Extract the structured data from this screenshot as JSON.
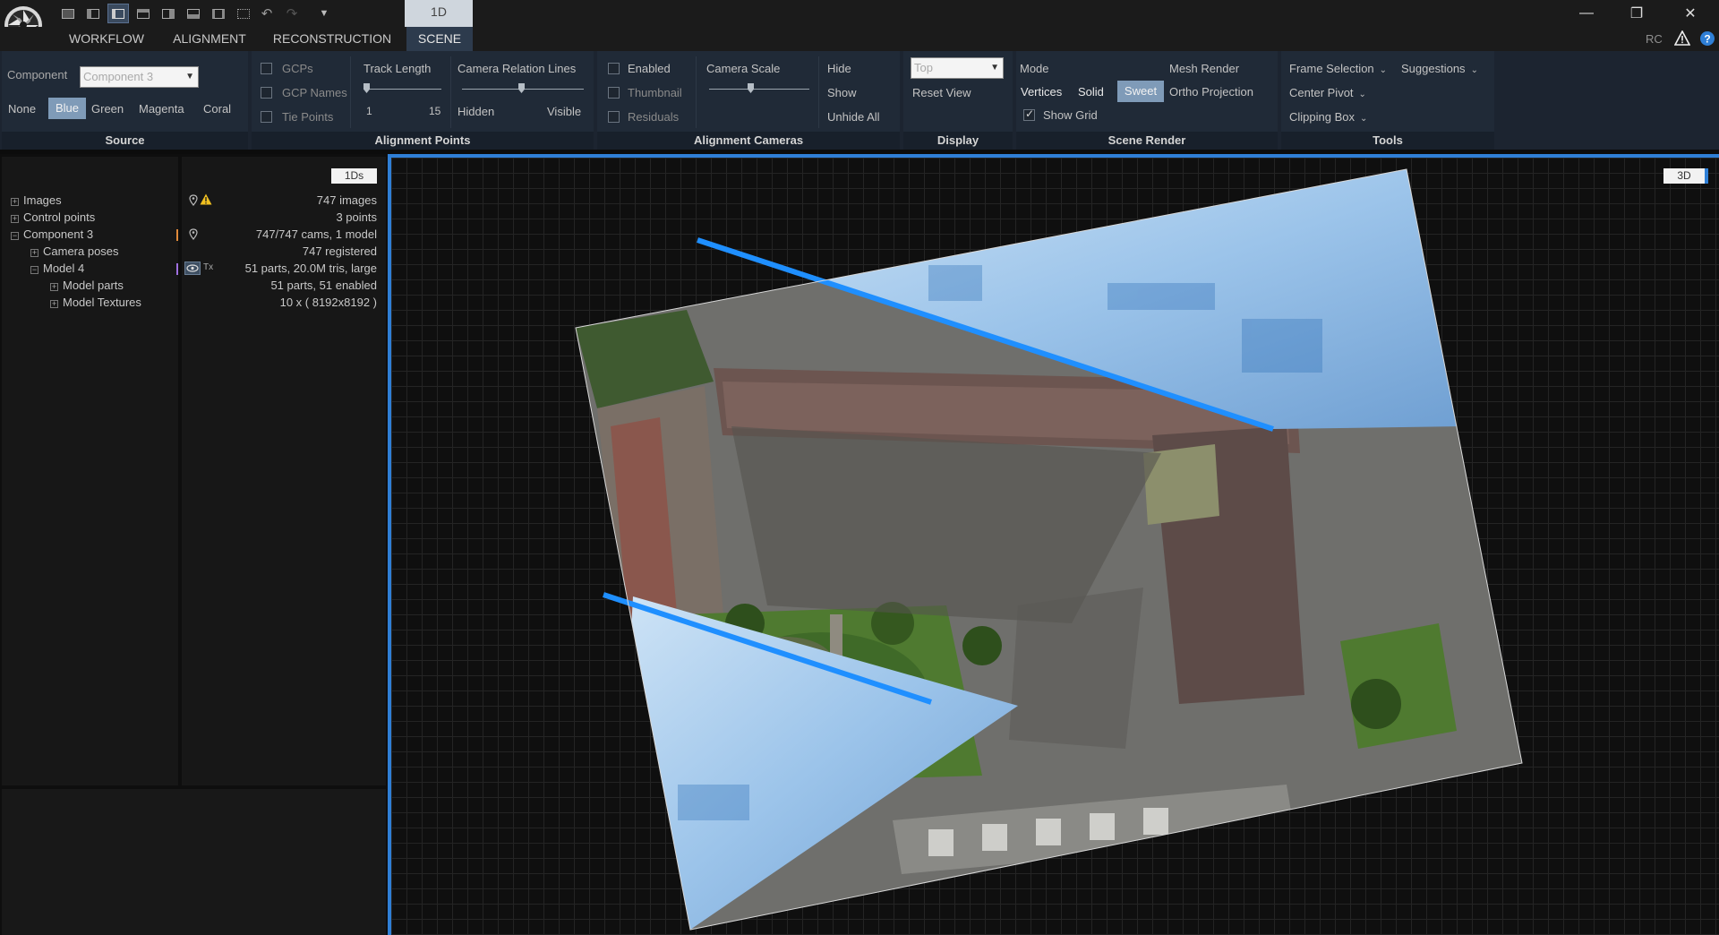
{
  "titlebar": {
    "tab_1d": "1D",
    "minimize": "—",
    "restore": "❐",
    "close": "✕"
  },
  "menu": {
    "tabs": [
      "WORKFLOW",
      "ALIGNMENT",
      "RECONSTRUCTION",
      "SCENE"
    ],
    "active_tab": "SCENE",
    "rc": "RC"
  },
  "source": {
    "component_label": "Component",
    "component_value": "Component 3",
    "colors": [
      "None",
      "Blue",
      "Green",
      "Magenta",
      "Coral"
    ],
    "selected_color": "Blue",
    "title": "Source"
  },
  "alignment_points": {
    "gcps": "GCPs",
    "gcp_names": "GCP Names",
    "tie_points": "Tie Points",
    "track_length": "Track Length",
    "track_min": "1",
    "track_max": "15",
    "camera_relation_lines": "Camera Relation Lines",
    "hidden": "Hidden",
    "visible": "Visible",
    "title": "Alignment Points"
  },
  "alignment_cameras": {
    "enabled": "Enabled",
    "thumbnail": "Thumbnail",
    "residuals": "Residuals",
    "camera_scale": "Camera Scale",
    "hide": "Hide",
    "show": "Show",
    "unhide_all": "Unhide All",
    "title": "Alignment Cameras"
  },
  "display": {
    "view_placeholder": "Top",
    "reset_view": "Reset View",
    "title": "Display"
  },
  "scene_render": {
    "mode": "Mode",
    "mesh_render": "Mesh Render",
    "vertices": "Vertices",
    "solid": "Solid",
    "sweet": "Sweet",
    "selected_mode": "Sweet",
    "ortho_projection": "Ortho Projection",
    "show_grid": "Show Grid",
    "show_grid_checked": true,
    "title": "Scene Render"
  },
  "tools": {
    "frame_selection": "Frame Selection",
    "suggestions": "Suggestions",
    "center_pivot": "Center Pivot",
    "clipping_box": "Clipping Box",
    "title": "Tools"
  },
  "tree": {
    "ds_badge": "1Ds",
    "rows": [
      {
        "label": "Images",
        "info": "747 images",
        "expander": "+"
      },
      {
        "label": "Control points",
        "info": "3 points",
        "expander": "+"
      },
      {
        "label": "Component 3",
        "info": "747/747 cams, 1 model",
        "expander": "−"
      },
      {
        "label": "Camera poses",
        "info": "747 registered",
        "expander": "+"
      },
      {
        "label": "Model 4",
        "info": "51 parts, 20.0M tris, large",
        "expander": "−"
      },
      {
        "label": "Model parts",
        "info": "51 parts, 51 enabled",
        "expander": "+"
      },
      {
        "label": "Model Textures",
        "info": "10 x ( 8192x8192 )",
        "expander": "+"
      }
    ],
    "tx_label": "Tx"
  },
  "viewport": {
    "badge": "3D",
    "accent_color": "#2f7fd6"
  },
  "colors": {
    "accent": "#2f7fd6",
    "selected_button": "#7f9bb8",
    "component_marker": "#e08a3a",
    "model_marker": "#a070e0",
    "warning": "#f0c020"
  }
}
